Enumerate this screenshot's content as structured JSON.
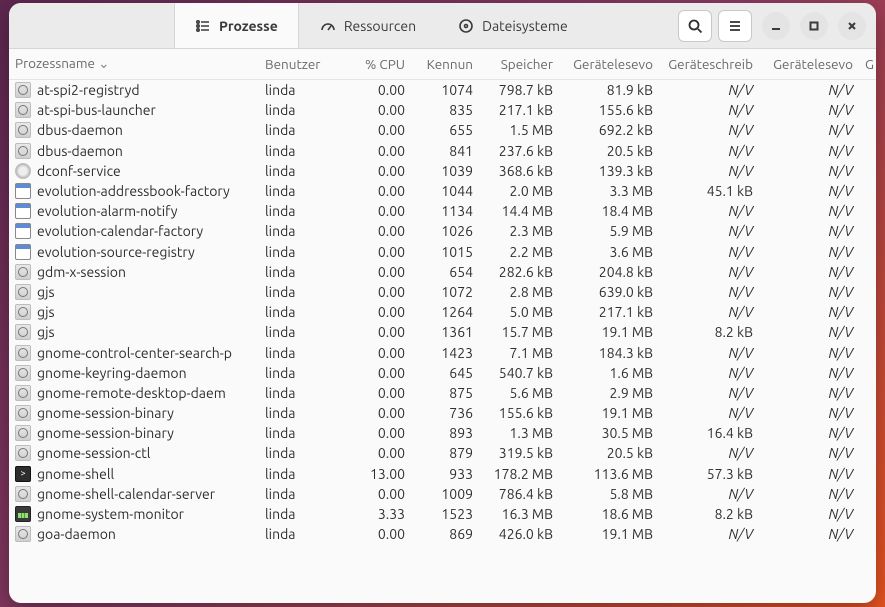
{
  "tabs": {
    "processes": "Prozesse",
    "resources": "Ressourcen",
    "filesystems": "Dateisysteme"
  },
  "columns": {
    "name": "Prozessname",
    "user": "Benutzer",
    "cpu": "% CPU",
    "pid": "Kennun",
    "mem": "Speicher",
    "read_total": "Gerätelesevo",
    "write_total": "Geräteschreib",
    "read_rate": "Gerätelesevo",
    "write_rate": "G"
  },
  "nv": "N/V",
  "rows": [
    {
      "icon": "gear",
      "name": "at-spi2-registryd",
      "user": "linda",
      "cpu": "0.00",
      "pid": "1074",
      "mem": "798.7 kB",
      "r": "81.9 kB",
      "w": "N/V",
      "rr": "N/V"
    },
    {
      "icon": "gear",
      "name": "at-spi-bus-launcher",
      "user": "linda",
      "cpu": "0.00",
      "pid": "835",
      "mem": "217.1 kB",
      "r": "155.6 kB",
      "w": "N/V",
      "rr": "N/V"
    },
    {
      "icon": "gear",
      "name": "dbus-daemon",
      "user": "linda",
      "cpu": "0.00",
      "pid": "655",
      "mem": "1.5 MB",
      "r": "692.2 kB",
      "w": "N/V",
      "rr": "N/V"
    },
    {
      "icon": "gear",
      "name": "dbus-daemon",
      "user": "linda",
      "cpu": "0.00",
      "pid": "841",
      "mem": "237.6 kB",
      "r": "20.5 kB",
      "w": "N/V",
      "rr": "N/V"
    },
    {
      "icon": "gear2",
      "name": "dconf-service",
      "user": "linda",
      "cpu": "0.00",
      "pid": "1039",
      "mem": "368.6 kB",
      "r": "139.3 kB",
      "w": "N/V",
      "rr": "N/V"
    },
    {
      "icon": "win",
      "name": "evolution-addressbook-factory",
      "user": "linda",
      "cpu": "0.00",
      "pid": "1044",
      "mem": "2.0 MB",
      "r": "3.3 MB",
      "w": "45.1 kB",
      "rr": "N/V"
    },
    {
      "icon": "win",
      "name": "evolution-alarm-notify",
      "user": "linda",
      "cpu": "0.00",
      "pid": "1134",
      "mem": "14.4 MB",
      "r": "18.4 MB",
      "w": "N/V",
      "rr": "N/V"
    },
    {
      "icon": "win",
      "name": "evolution-calendar-factory",
      "user": "linda",
      "cpu": "0.00",
      "pid": "1026",
      "mem": "2.3 MB",
      "r": "5.9 MB",
      "w": "N/V",
      "rr": "N/V"
    },
    {
      "icon": "win",
      "name": "evolution-source-registry",
      "user": "linda",
      "cpu": "0.00",
      "pid": "1015",
      "mem": "2.2 MB",
      "r": "3.6 MB",
      "w": "N/V",
      "rr": "N/V"
    },
    {
      "icon": "gear",
      "name": "gdm-x-session",
      "user": "linda",
      "cpu": "0.00",
      "pid": "654",
      "mem": "282.6 kB",
      "r": "204.8 kB",
      "w": "N/V",
      "rr": "N/V"
    },
    {
      "icon": "gear",
      "name": "gjs",
      "user": "linda",
      "cpu": "0.00",
      "pid": "1072",
      "mem": "2.8 MB",
      "r": "639.0 kB",
      "w": "N/V",
      "rr": "N/V"
    },
    {
      "icon": "gear",
      "name": "gjs",
      "user": "linda",
      "cpu": "0.00",
      "pid": "1264",
      "mem": "5.0 MB",
      "r": "217.1 kB",
      "w": "N/V",
      "rr": "N/V"
    },
    {
      "icon": "gear",
      "name": "gjs",
      "user": "linda",
      "cpu": "0.00",
      "pid": "1361",
      "mem": "15.7 MB",
      "r": "19.1 MB",
      "w": "8.2 kB",
      "rr": "N/V"
    },
    {
      "icon": "gear",
      "name": "gnome-control-center-search-p",
      "user": "linda",
      "cpu": "0.00",
      "pid": "1423",
      "mem": "7.1 MB",
      "r": "184.3 kB",
      "w": "N/V",
      "rr": "N/V"
    },
    {
      "icon": "gear",
      "name": "gnome-keyring-daemon",
      "user": "linda",
      "cpu": "0.00",
      "pid": "645",
      "mem": "540.7 kB",
      "r": "1.6 MB",
      "w": "N/V",
      "rr": "N/V"
    },
    {
      "icon": "gear",
      "name": "gnome-remote-desktop-daem",
      "user": "linda",
      "cpu": "0.00",
      "pid": "875",
      "mem": "5.6 MB",
      "r": "2.9 MB",
      "w": "N/V",
      "rr": "N/V"
    },
    {
      "icon": "gear",
      "name": "gnome-session-binary",
      "user": "linda",
      "cpu": "0.00",
      "pid": "736",
      "mem": "155.6 kB",
      "r": "19.1 MB",
      "w": "N/V",
      "rr": "N/V"
    },
    {
      "icon": "gear",
      "name": "gnome-session-binary",
      "user": "linda",
      "cpu": "0.00",
      "pid": "893",
      "mem": "1.3 MB",
      "r": "30.5 MB",
      "w": "16.4 kB",
      "rr": "N/V"
    },
    {
      "icon": "gear",
      "name": "gnome-session-ctl",
      "user": "linda",
      "cpu": "0.00",
      "pid": "879",
      "mem": "319.5 kB",
      "r": "20.5 kB",
      "w": "N/V",
      "rr": "N/V"
    },
    {
      "icon": "term",
      "name": "gnome-shell",
      "user": "linda",
      "cpu": "13.00",
      "pid": "933",
      "mem": "178.2 MB",
      "r": "113.6 MB",
      "w": "57.3 kB",
      "rr": "N/V"
    },
    {
      "icon": "gear",
      "name": "gnome-shell-calendar-server",
      "user": "linda",
      "cpu": "0.00",
      "pid": "1009",
      "mem": "786.4 kB",
      "r": "5.8 MB",
      "w": "N/V",
      "rr": "N/V"
    },
    {
      "icon": "mon",
      "name": "gnome-system-monitor",
      "user": "linda",
      "cpu": "3.33",
      "pid": "1523",
      "mem": "16.3 MB",
      "r": "18.6 MB",
      "w": "8.2 kB",
      "rr": "N/V"
    },
    {
      "icon": "gear",
      "name": "goa-daemon",
      "user": "linda",
      "cpu": "0.00",
      "pid": "869",
      "mem": "426.0 kB",
      "r": "19.1 MB",
      "w": "N/V",
      "rr": "N/V"
    }
  ]
}
